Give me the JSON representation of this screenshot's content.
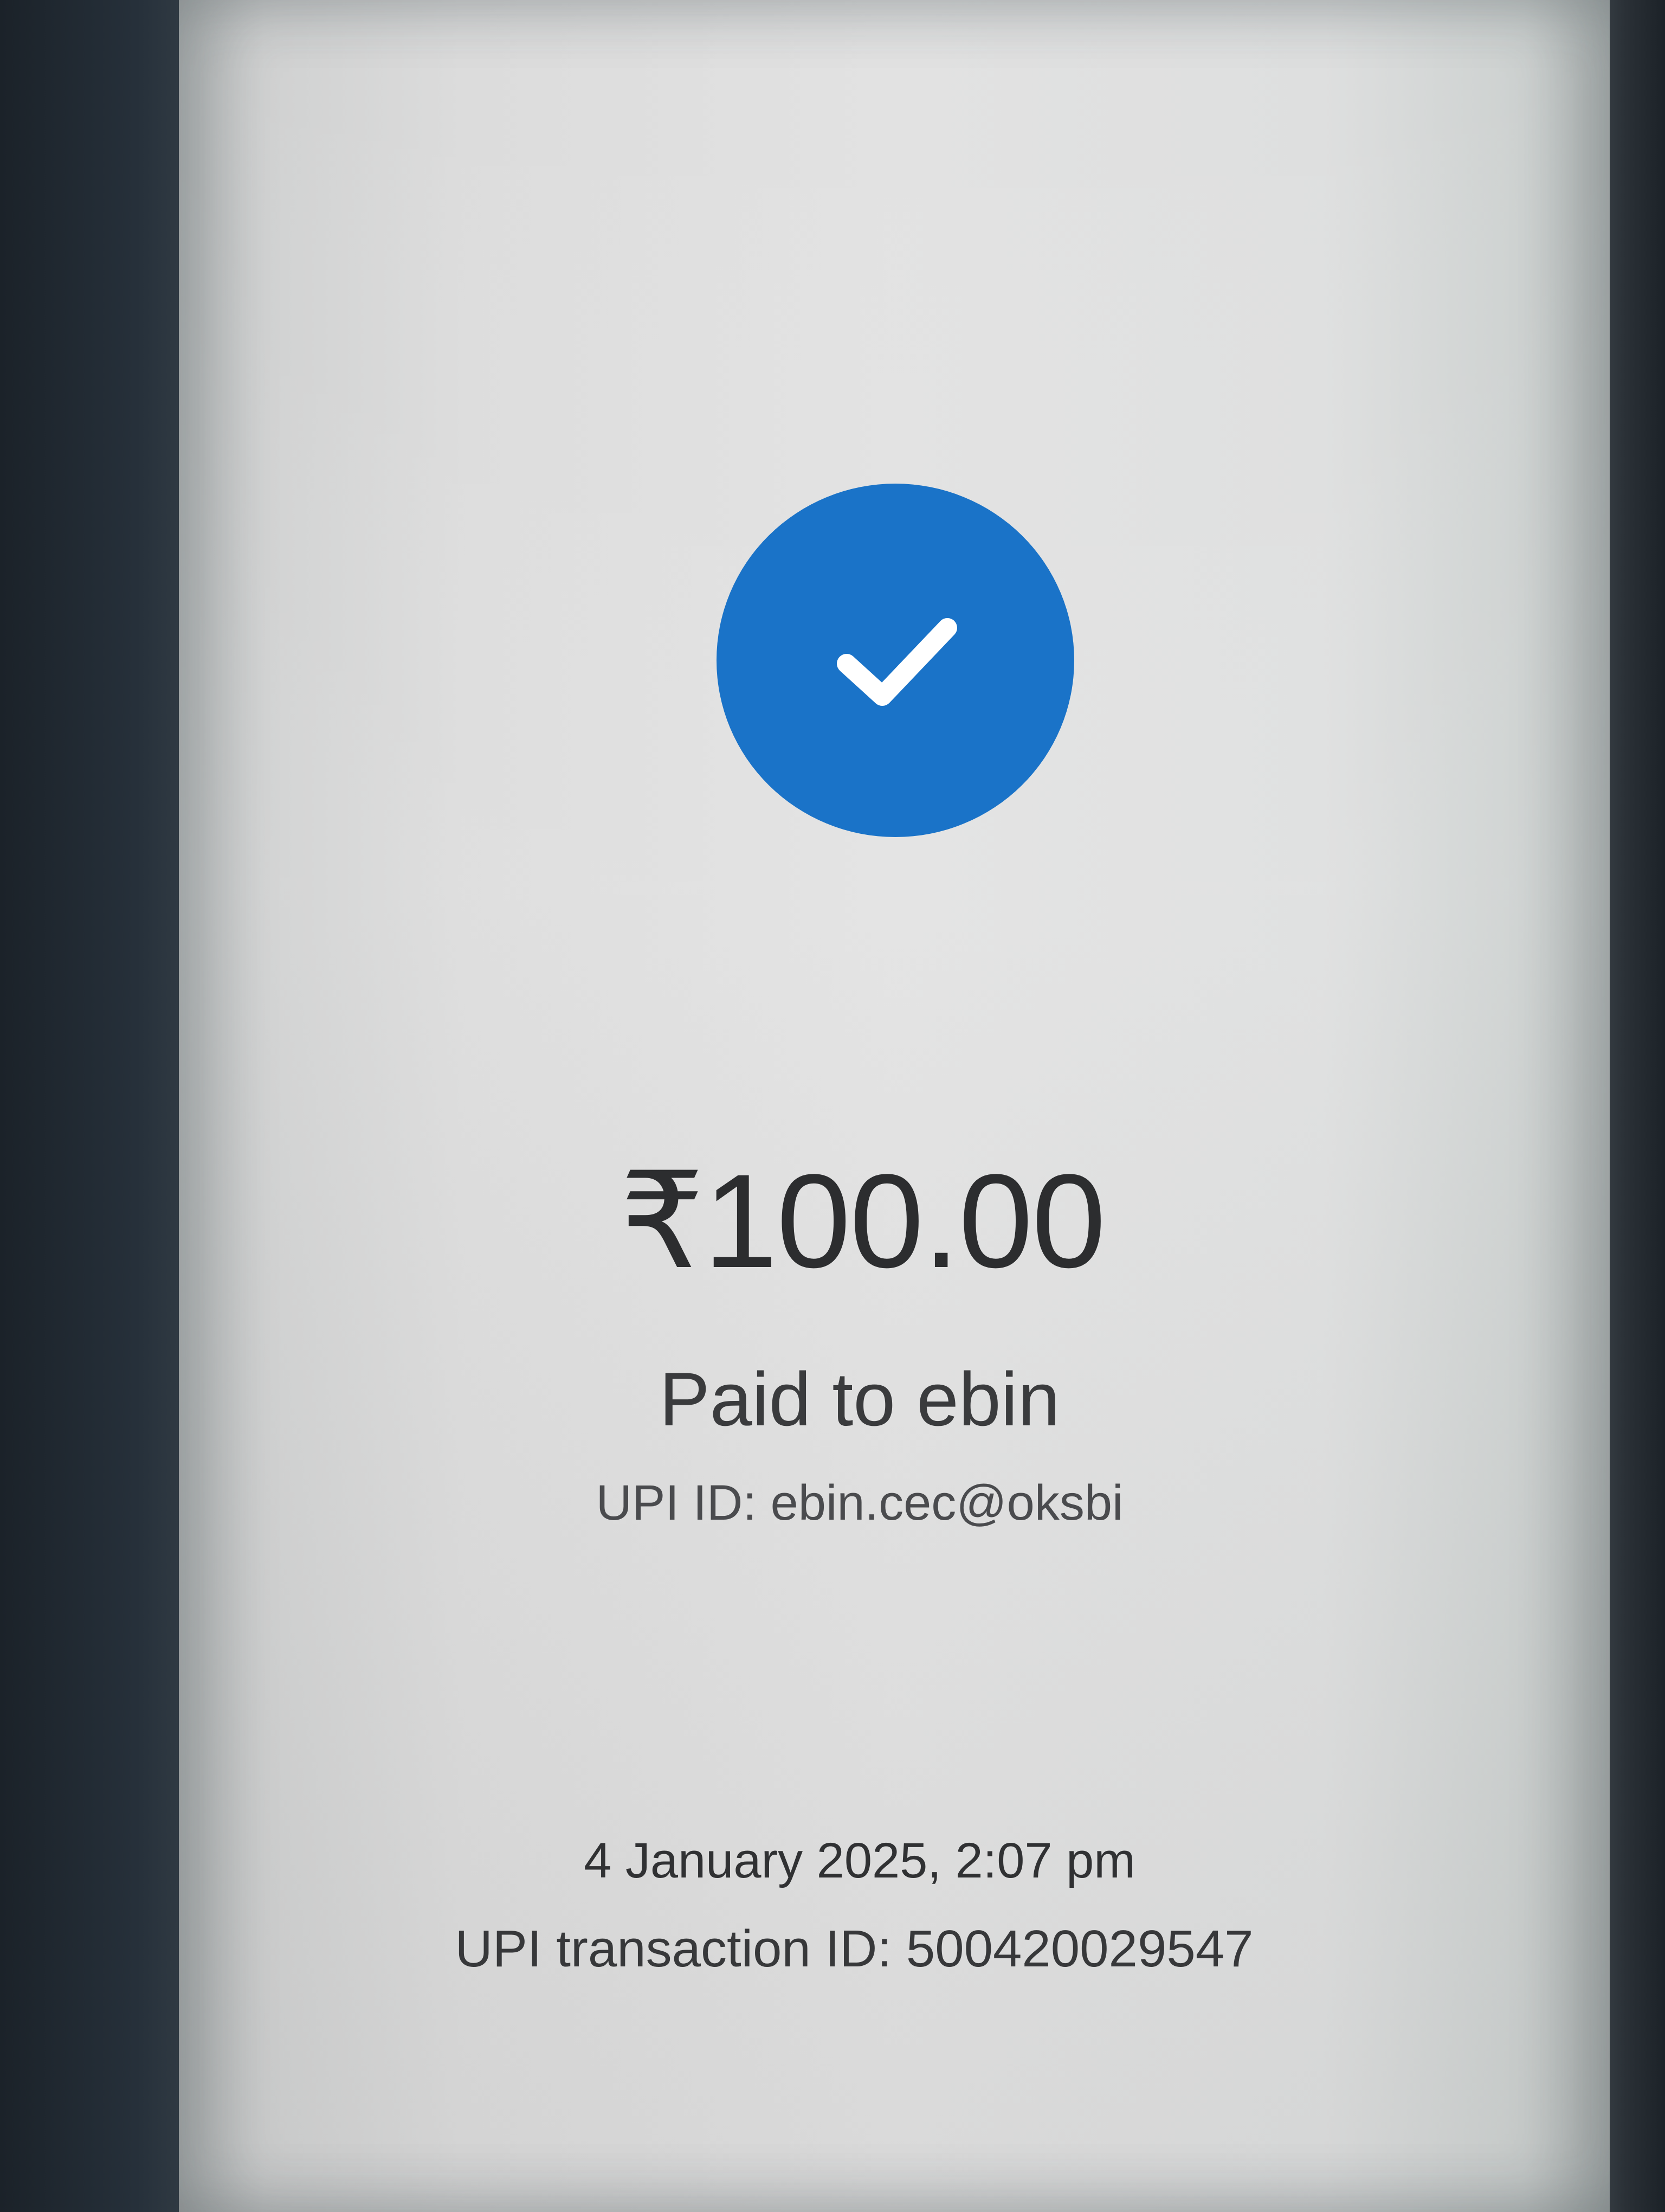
{
  "payment": {
    "status_icon": "check-icon",
    "accent_color": "#1a73c8",
    "amount": "₹100.00",
    "paid_to": "Paid to ebin",
    "upi_id": "UPI ID: ebin.cec@oksbi",
    "date_time": "4 January 2025, 2:07 pm",
    "transaction_id": "UPI transaction ID: 500420029547"
  }
}
